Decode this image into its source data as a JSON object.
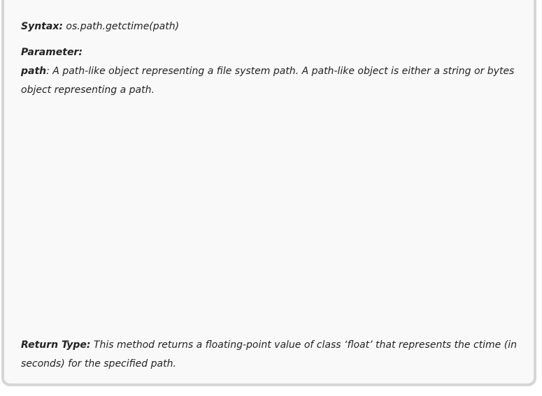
{
  "syntax": {
    "label": "Syntax:",
    "value": " os.path.getctime(path)"
  },
  "parameter": {
    "heading": "Parameter:",
    "name": "path",
    "description": ": A path-like object representing a file system path. A path-like object is either a string or bytes object representing a path."
  },
  "return_type": {
    "label": "Return Type:",
    "description": " This method returns a floating-point value of class ‘float’ that represents the ctime (in seconds) for the specified path."
  }
}
